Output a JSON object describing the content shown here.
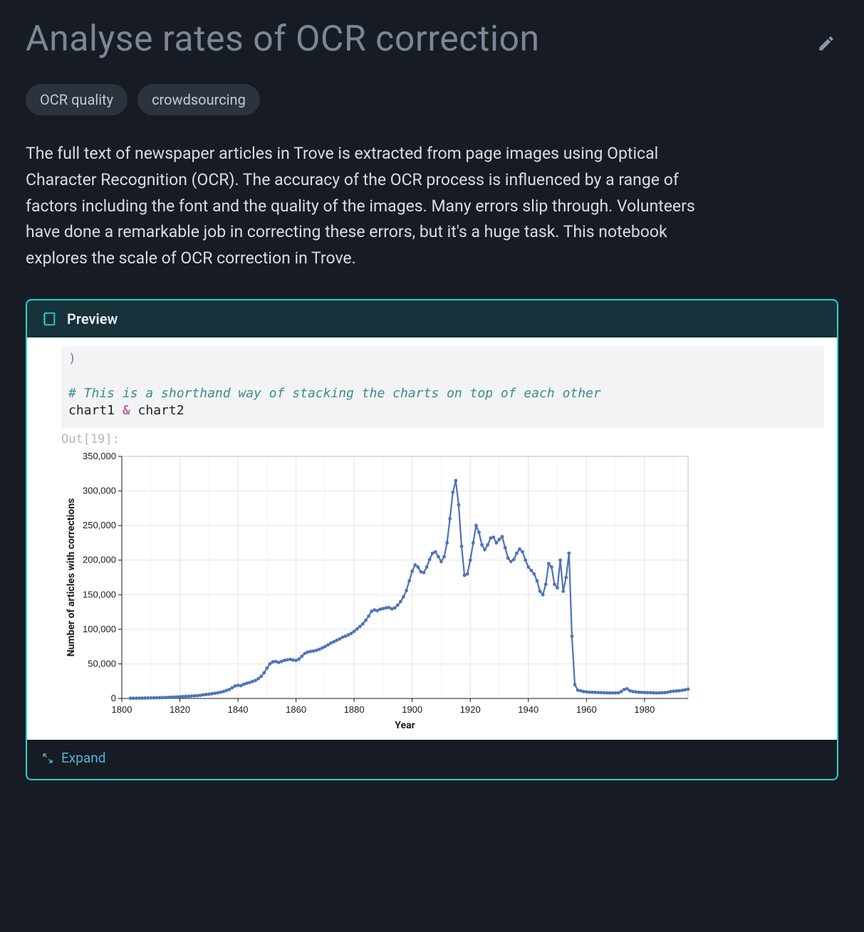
{
  "title": "Analyse rates of OCR correction",
  "tags": [
    "OCR quality",
    "crowdsourcing"
  ],
  "description": "The full text of newspaper articles in Trove is extracted from page images using Optical Character Recognition (OCR). The accuracy of the OCR process is influenced by a range of factors including the font and the quality of the images. Many errors slip through. Volunteers have done a remarkable job in correcting these errors, but it's a huge task. This notebook explores the scale of OCR correction in Trove.",
  "preview": {
    "label": "Preview",
    "code_paren": ")",
    "code_comment": "# This is a shorthand way of stacking the charts on top of each other",
    "code_line": "chart1 & chart2",
    "code_lhs": "chart1 ",
    "code_rhs": " chart2",
    "code_amp": "&",
    "out_label": "Out[19]:"
  },
  "expand_label": "Expand",
  "chart_data": {
    "type": "line",
    "xlabel": "Year",
    "ylabel": "Number of articles with corrections",
    "xlim": [
      1800,
      1995
    ],
    "ylim": [
      0,
      350000
    ],
    "x_ticks": [
      1800,
      1820,
      1840,
      1860,
      1880,
      1900,
      1920,
      1940,
      1960,
      1980
    ],
    "y_ticks": [
      0,
      50000,
      100000,
      150000,
      200000,
      250000,
      300000,
      350000
    ],
    "y_tick_labels": [
      "0",
      "50,000",
      "100,000",
      "150,000",
      "200,000",
      "250,000",
      "300,000",
      "350,000"
    ],
    "series": [
      {
        "name": "articles_with_corrections",
        "x": [
          1803,
          1804,
          1805,
          1806,
          1807,
          1808,
          1809,
          1810,
          1811,
          1812,
          1813,
          1814,
          1815,
          1816,
          1817,
          1818,
          1819,
          1820,
          1821,
          1822,
          1823,
          1824,
          1825,
          1826,
          1827,
          1828,
          1829,
          1830,
          1831,
          1832,
          1833,
          1834,
          1835,
          1836,
          1837,
          1838,
          1839,
          1840,
          1841,
          1842,
          1843,
          1844,
          1845,
          1846,
          1847,
          1848,
          1849,
          1850,
          1851,
          1852,
          1853,
          1854,
          1855,
          1856,
          1857,
          1858,
          1859,
          1860,
          1861,
          1862,
          1863,
          1864,
          1865,
          1866,
          1867,
          1868,
          1869,
          1870,
          1871,
          1872,
          1873,
          1874,
          1875,
          1876,
          1877,
          1878,
          1879,
          1880,
          1881,
          1882,
          1883,
          1884,
          1885,
          1886,
          1887,
          1888,
          1889,
          1890,
          1891,
          1892,
          1893,
          1894,
          1895,
          1896,
          1897,
          1898,
          1899,
          1900,
          1901,
          1902,
          1903,
          1904,
          1905,
          1906,
          1907,
          1908,
          1909,
          1910,
          1911,
          1912,
          1913,
          1914,
          1915,
          1916,
          1917,
          1918,
          1919,
          1920,
          1921,
          1922,
          1923,
          1924,
          1925,
          1926,
          1927,
          1928,
          1929,
          1930,
          1931,
          1932,
          1933,
          1934,
          1935,
          1936,
          1937,
          1938,
          1939,
          1940,
          1941,
          1942,
          1943,
          1944,
          1945,
          1946,
          1947,
          1948,
          1949,
          1950,
          1951,
          1952,
          1953,
          1954,
          1955,
          1956,
          1957,
          1958,
          1959,
          1960,
          1961,
          1962,
          1963,
          1964,
          1965,
          1966,
          1967,
          1968,
          1969,
          1970,
          1971,
          1972,
          1973,
          1974,
          1975,
          1976,
          1977,
          1978,
          1979,
          1980,
          1981,
          1982,
          1983,
          1984,
          1985,
          1986,
          1987,
          1988,
          1989,
          1990,
          1991,
          1992,
          1993,
          1994,
          1995
        ],
        "y": [
          300,
          300,
          400,
          500,
          500,
          600,
          700,
          800,
          900,
          1000,
          1100,
          1200,
          1400,
          1600,
          1800,
          2000,
          2200,
          2500,
          2800,
          3000,
          3200,
          3500,
          3800,
          4000,
          4500,
          5200,
          5800,
          6200,
          6800,
          7500,
          8200,
          9000,
          10000,
          11500,
          13000,
          15500,
          18000,
          19000,
          18500,
          20500,
          22000,
          23000,
          24500,
          26000,
          28500,
          32000,
          37000,
          44000,
          50000,
          53000,
          53500,
          52000,
          53500,
          55000,
          56000,
          56500,
          55500,
          55000,
          57000,
          61000,
          65000,
          67000,
          68000,
          68500,
          69500,
          71000,
          73000,
          75000,
          77500,
          80000,
          82000,
          84000,
          86000,
          88500,
          90000,
          92000,
          94000,
          97000,
          100500,
          104000,
          108000,
          113000,
          119000,
          126000,
          128000,
          127000,
          129000,
          130000,
          131000,
          131500,
          129500,
          131000,
          135000,
          140000,
          147000,
          156000,
          170000,
          184000,
          193000,
          190000,
          183000,
          182000,
          190000,
          201000,
          210000,
          212000,
          205000,
          198000,
          205000,
          225000,
          260000,
          298000,
          315000,
          280000,
          220000,
          178000,
          180000,
          200000,
          225000,
          250000,
          240000,
          222000,
          215000,
          222000,
          232000,
          233000,
          225000,
          230000,
          234000,
          218000,
          203000,
          198000,
          201000,
          210000,
          216000,
          212000,
          200000,
          190000,
          185000,
          180000,
          170000,
          155000,
          150000,
          165000,
          195000,
          190000,
          165000,
          160000,
          200000,
          155000,
          175000,
          210000,
          90000,
          20000,
          12000,
          11000,
          10000,
          9500,
          9000,
          9000,
          8800,
          8600,
          8500,
          8200,
          8100,
          8000,
          8000,
          8000,
          8200,
          10000,
          13000,
          14000,
          11000,
          10000,
          9500,
          9000,
          8800,
          8600,
          8500,
          8400,
          8200,
          8000,
          8000,
          8200,
          8500,
          9000,
          10000,
          10500,
          10800,
          11200,
          11800,
          12500,
          13500,
          14500
        ],
        "color": "#4f72b8"
      }
    ]
  }
}
